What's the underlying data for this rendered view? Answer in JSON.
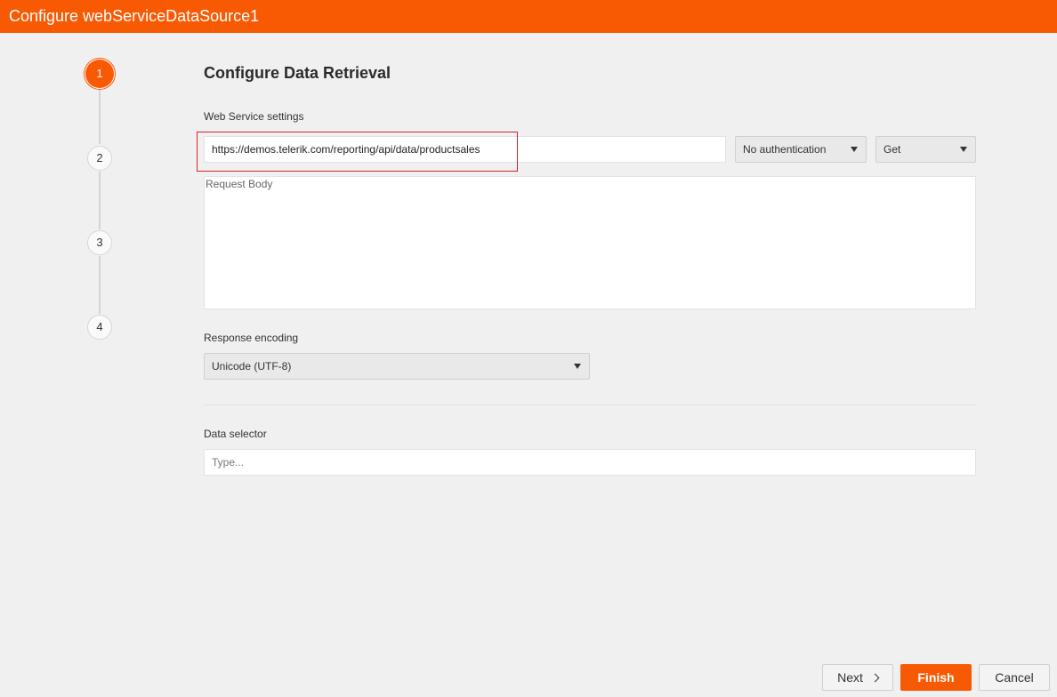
{
  "window": {
    "title": "Configure webServiceDataSource1"
  },
  "stepper": {
    "steps": [
      "1",
      "2",
      "3",
      "4"
    ],
    "active_step": "1"
  },
  "main": {
    "title": "Configure Data Retrieval",
    "web_service": {
      "label": "Web Service settings",
      "url_value": "https://demos.telerik.com/reporting/api/data/productsales",
      "auth_selected": "No authentication",
      "method_selected": "Get"
    },
    "request_body": {
      "placeholder": "Request Body"
    },
    "response_encoding": {
      "label": "Response encoding",
      "selected": "Unicode (UTF-8)"
    },
    "data_selector": {
      "label": "Data selector",
      "placeholder": "Type..."
    }
  },
  "footer": {
    "next_label": "Next",
    "finish_label": "Finish",
    "cancel_label": "Cancel"
  },
  "colors": {
    "accent": "#f85a04",
    "highlight_border": "#d9232a",
    "background": "#f0f0f0"
  },
  "icons": [
    "dropdown-caret-icon",
    "chevron-right-icon"
  ]
}
